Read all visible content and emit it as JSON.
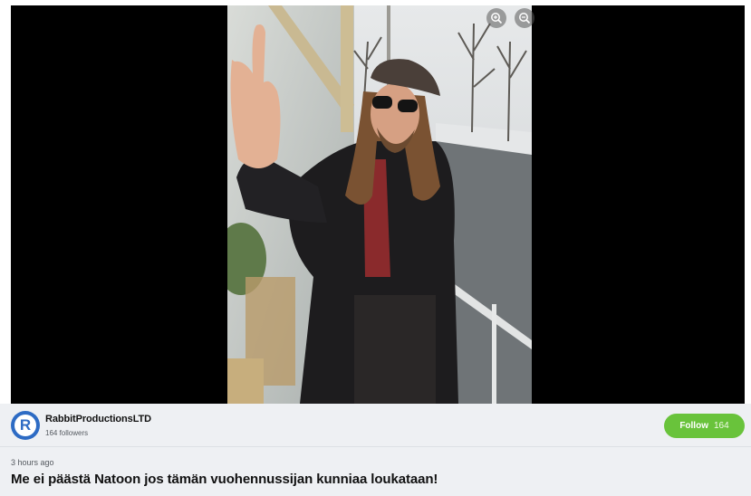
{
  "author": {
    "name": "RabbitProductionsLTD",
    "avatar_letter": "R",
    "followers_text": "164 followers"
  },
  "follow_button": {
    "label": "Follow",
    "count": "164"
  },
  "post": {
    "timestamp": "3 hours ago",
    "title": "Me ei päästä Natoon jos tämän vuohennussijan kunniaa loukataan!"
  },
  "colors": {
    "viewer_background": "#000000",
    "follow_green": "#69c33b",
    "avatar_blue": "#2d6bc4",
    "info_background": "#eef0f3"
  },
  "icons": [
    "zoom-in-icon",
    "zoom-out-icon"
  ]
}
